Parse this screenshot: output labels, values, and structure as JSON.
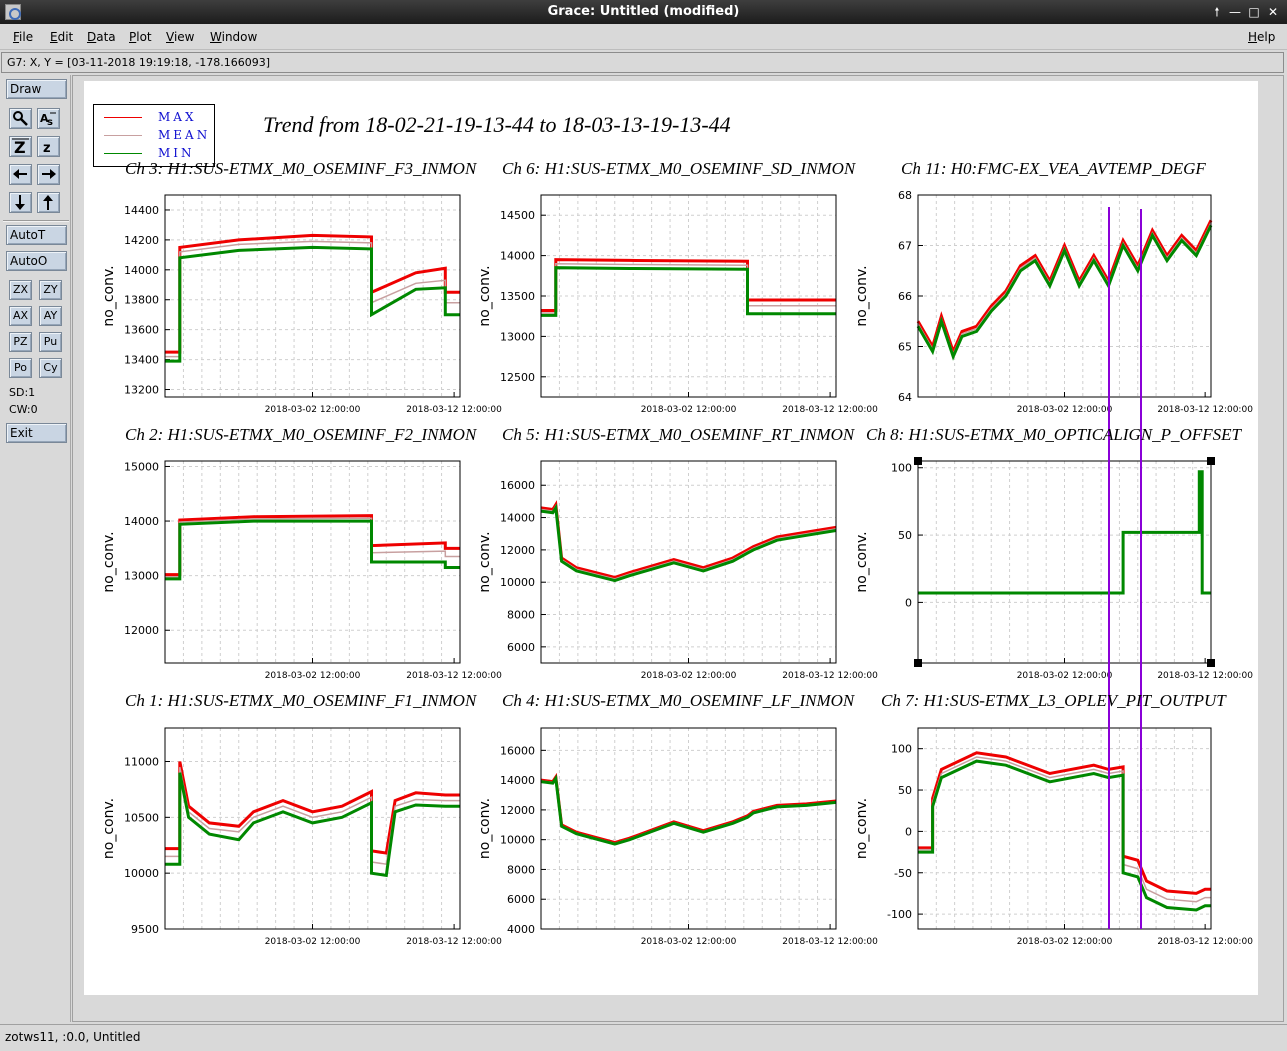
{
  "window": {
    "title": "Grace: Untitled (modified)",
    "controls": [
      "up-arrow-icon",
      "minimize-icon",
      "maximize-icon",
      "close-icon"
    ]
  },
  "menubar": {
    "items": [
      "File",
      "Edit",
      "Data",
      "Plot",
      "View",
      "Window"
    ],
    "help": "Help"
  },
  "locator": "G7: X, Y = [03-11-2018 19:19:18, -178.166093]",
  "toolbar": {
    "draw": "Draw",
    "autot": "AutoT",
    "autoo": "AutoO",
    "zx": "ZX",
    "zy": "ZY",
    "ax": "AX",
    "ay": "AY",
    "pz": "PZ",
    "pu": "Pu",
    "po": "Po",
    "cy": "Cy",
    "sd": "SD:1",
    "cw": "CW:0",
    "exit": "Exit",
    "icons": [
      "magnifier-icon",
      "autoscale-text-icon",
      "zoom-in-icon",
      "zoom-out-icon",
      "arrow-left-icon",
      "arrow-right-icon",
      "arrow-down-icon",
      "arrow-up-icon"
    ]
  },
  "status": "zotws11, :0.0, Untitled",
  "plot": {
    "title": "Trend from 18-02-21-19-13-44 to 18-03-13-19-13-44",
    "legend": [
      {
        "label": "MAX",
        "color": "#ee0000"
      },
      {
        "label": "MEAN",
        "color": "#c8a0a0"
      },
      {
        "label": "MIN",
        "color": "#008800"
      }
    ],
    "colors": {
      "max": "#ee0000",
      "mean": "#c8a0a0",
      "min": "#008800",
      "cursor": "#8a00d8"
    }
  },
  "chart_data": [
    {
      "type": "line",
      "title": "Ch 3: H1:SUS-ETMX_M0_OSEMINF_F3_INMON",
      "ylabel": "no_conv.",
      "xticks": [
        "2018-03-02 12:00:00",
        "2018-03-12 12:00:00"
      ],
      "yticks": [
        13200,
        13400,
        13600,
        13800,
        14000,
        14200,
        14400
      ],
      "ylim": [
        13150,
        14500
      ],
      "x": [
        0,
        0.05,
        0.05,
        0.25,
        0.5,
        0.7,
        0.7,
        0.85,
        0.95,
        0.95,
        1
      ],
      "series": [
        {
          "name": "MAX",
          "values": [
            13450,
            13450,
            14150,
            14200,
            14230,
            14220,
            13850,
            13980,
            14010,
            13850,
            13850
          ]
        },
        {
          "name": "MEAN",
          "values": [
            13420,
            13420,
            14120,
            14170,
            14190,
            14180,
            13780,
            13910,
            13930,
            13780,
            13780
          ]
        },
        {
          "name": "MIN",
          "values": [
            13390,
            13390,
            14080,
            14130,
            14150,
            14140,
            13700,
            13870,
            13880,
            13700,
            13700
          ]
        }
      ]
    },
    {
      "type": "line",
      "title": "Ch 6: H1:SUS-ETMX_M0_OSEMINF_SD_INMON",
      "ylabel": "no_conv.",
      "xticks": [
        "2018-03-02 12:00:00",
        "2018-03-12 12:00:00"
      ],
      "yticks": [
        12500,
        13000,
        13500,
        14000,
        14500
      ],
      "ylim": [
        12250,
        14750
      ],
      "x": [
        0,
        0.05,
        0.05,
        0.3,
        0.7,
        0.7,
        1
      ],
      "series": [
        {
          "name": "MAX",
          "values": [
            13320,
            13320,
            13950,
            13940,
            13930,
            13450,
            13450
          ]
        },
        {
          "name": "MEAN",
          "values": [
            13290,
            13290,
            13900,
            13890,
            13880,
            13380,
            13380
          ]
        },
        {
          "name": "MIN",
          "values": [
            13260,
            13260,
            13850,
            13840,
            13830,
            13280,
            13280
          ]
        }
      ]
    },
    {
      "type": "line",
      "title": "Ch 11: H0:FMC-EX_VEA_AVTEMP_DEGF",
      "ylabel": "no_conv.",
      "xticks": [
        "2018-03-02 12:00:00",
        "2018-03-12 12:00:00"
      ],
      "yticks": [
        64,
        65,
        66,
        67,
        68
      ],
      "ylim": [
        64,
        68
      ],
      "x": [
        0,
        0.05,
        0.08,
        0.12,
        0.15,
        0.2,
        0.25,
        0.3,
        0.35,
        0.4,
        0.45,
        0.5,
        0.55,
        0.6,
        0.65,
        0.7,
        0.75,
        0.8,
        0.85,
        0.9,
        0.95,
        1
      ],
      "series": [
        {
          "name": "MAX",
          "values": [
            65.5,
            65.0,
            65.6,
            64.9,
            65.3,
            65.4,
            65.8,
            66.1,
            66.6,
            66.8,
            66.3,
            67.0,
            66.3,
            66.8,
            66.3,
            67.1,
            66.6,
            67.3,
            66.8,
            67.2,
            66.9,
            67.5
          ]
        },
        {
          "name": "MEAN",
          "values": [
            65.45,
            64.95,
            65.55,
            64.85,
            65.25,
            65.35,
            65.75,
            66.05,
            66.55,
            66.75,
            66.25,
            66.95,
            66.25,
            66.75,
            66.25,
            67.05,
            66.55,
            67.25,
            66.75,
            67.15,
            66.85,
            67.45
          ]
        },
        {
          "name": "MIN",
          "values": [
            65.4,
            64.9,
            65.5,
            64.8,
            65.2,
            65.3,
            65.7,
            66.0,
            66.5,
            66.7,
            66.2,
            66.9,
            66.2,
            66.7,
            66.2,
            67.0,
            66.5,
            67.2,
            66.7,
            67.1,
            66.8,
            67.4
          ]
        }
      ]
    },
    {
      "type": "line",
      "title": "Ch 2: H1:SUS-ETMX_M0_OSEMINF_F2_INMON",
      "ylabel": "no_conv.",
      "xticks": [
        "2018-03-02 12:00:00",
        "2018-03-12 12:00:00"
      ],
      "yticks": [
        12000,
        13000,
        14000,
        15000
      ],
      "ylim": [
        11400,
        15100
      ],
      "x": [
        0,
        0.05,
        0.05,
        0.3,
        0.7,
        0.7,
        0.95,
        0.95,
        1
      ],
      "series": [
        {
          "name": "MAX",
          "values": [
            13020,
            13020,
            14020,
            14080,
            14100,
            13550,
            13600,
            13500,
            13500
          ]
        },
        {
          "name": "MEAN",
          "values": [
            12980,
            12980,
            13980,
            14040,
            14050,
            13420,
            13450,
            13350,
            13350
          ]
        },
        {
          "name": "MIN",
          "values": [
            12940,
            12940,
            13940,
            14000,
            14000,
            13250,
            13250,
            13150,
            13150
          ]
        }
      ]
    },
    {
      "type": "line",
      "title": "Ch 5: H1:SUS-ETMX_M0_OSEMINF_RT_INMON",
      "ylabel": "no_conv.",
      "xticks": [
        "2018-03-02 12:00:00",
        "2018-03-12 12:00:00"
      ],
      "yticks": [
        6000,
        8000,
        10000,
        12000,
        14000,
        16000
      ],
      "ylim": [
        5000,
        17500
      ],
      "x": [
        0,
        0.04,
        0.05,
        0.07,
        0.12,
        0.25,
        0.3,
        0.45,
        0.55,
        0.65,
        0.7,
        0.72,
        0.8,
        0.9,
        1
      ],
      "series": [
        {
          "name": "MAX",
          "values": [
            14600,
            14500,
            14800,
            11500,
            10900,
            10300,
            10600,
            11400,
            10900,
            11500,
            12000,
            12200,
            12800,
            13100,
            13400
          ]
        },
        {
          "name": "MEAN",
          "values": [
            14500,
            14400,
            14700,
            11400,
            10800,
            10200,
            10500,
            11300,
            10800,
            11400,
            11900,
            12100,
            12700,
            13000,
            13300
          ]
        },
        {
          "name": "MIN",
          "values": [
            14400,
            14300,
            14600,
            11300,
            10700,
            10100,
            10400,
            11200,
            10700,
            11300,
            11800,
            12000,
            12600,
            12900,
            13200
          ]
        }
      ]
    },
    {
      "type": "line",
      "title": "Ch 8: H1:SUS-ETMX_M0_OPTICALIGN_P_OFFSET",
      "ylabel": "no_conv.",
      "xticks": [
        "2018-03-02 12:00:00",
        "2018-03-12 12:00:00"
      ],
      "yticks": [
        0,
        50,
        100
      ],
      "ylim": [
        -45,
        105
      ],
      "x": [
        0,
        0.7,
        0.7,
        0.96,
        0.96,
        0.97,
        0.97,
        1
      ],
      "series": [
        {
          "name": "MIN",
          "values": [
            7,
            7,
            52,
            52,
            97,
            97,
            7,
            7
          ]
        }
      ]
    },
    {
      "type": "line",
      "title": "Ch 1: H1:SUS-ETMX_M0_OSEMINF_F1_INMON",
      "ylabel": "no_conv.",
      "xticks": [
        "2018-03-02 12:00:00",
        "2018-03-12 12:00:00"
      ],
      "yticks": [
        9500,
        10000,
        10500,
        11000
      ],
      "ylim": [
        9500,
        11300
      ],
      "x": [
        0,
        0.05,
        0.05,
        0.08,
        0.15,
        0.25,
        0.3,
        0.4,
        0.5,
        0.6,
        0.7,
        0.7,
        0.75,
        0.78,
        0.85,
        0.95,
        0.95,
        1
      ],
      "series": [
        {
          "name": "MAX",
          "values": [
            10220,
            10220,
            11000,
            10600,
            10450,
            10420,
            10550,
            10650,
            10550,
            10600,
            10730,
            10200,
            10180,
            10650,
            10720,
            10700,
            10700,
            10700
          ]
        },
        {
          "name": "MEAN",
          "values": [
            10150,
            10150,
            10950,
            10550,
            10400,
            10370,
            10500,
            10600,
            10500,
            10550,
            10680,
            10100,
            10080,
            10600,
            10660,
            10650,
            10650,
            10650
          ]
        },
        {
          "name": "MIN",
          "values": [
            10080,
            10080,
            10900,
            10500,
            10350,
            10300,
            10450,
            10550,
            10450,
            10500,
            10630,
            10000,
            9980,
            10550,
            10610,
            10600,
            10600,
            10600
          ]
        }
      ]
    },
    {
      "type": "line",
      "title": "Ch 4: H1:SUS-ETMX_M0_OSEMINF_LF_INMON",
      "ylabel": "no_conv.",
      "xticks": [
        "2018-03-02 12:00:00",
        "2018-03-12 12:00:00"
      ],
      "yticks": [
        4000,
        6000,
        8000,
        10000,
        12000,
        14000,
        16000
      ],
      "ylim": [
        4000,
        17500
      ],
      "x": [
        0,
        0.04,
        0.05,
        0.07,
        0.12,
        0.25,
        0.3,
        0.45,
        0.55,
        0.65,
        0.7,
        0.72,
        0.8,
        0.9,
        1
      ],
      "series": [
        {
          "name": "MAX",
          "values": [
            14000,
            13900,
            14200,
            11000,
            10500,
            9800,
            10100,
            11200,
            10600,
            11200,
            11600,
            11900,
            12300,
            12400,
            12600
          ]
        },
        {
          "name": "MEAN",
          "values": [
            13950,
            13850,
            14150,
            10950,
            10450,
            9750,
            10050,
            11150,
            10550,
            11150,
            11550,
            11850,
            12250,
            12350,
            12550
          ]
        },
        {
          "name": "MIN",
          "values": [
            13900,
            13800,
            14100,
            10900,
            10400,
            9700,
            10000,
            11100,
            10500,
            11100,
            11500,
            11800,
            12200,
            12300,
            12500
          ]
        }
      ]
    },
    {
      "type": "line",
      "title": "Ch 7: H1:SUS-ETMX_L3_OPLEV_PIT_OUTPUT",
      "ylabel": "no_conv.",
      "xticks": [
        "2018-03-02 12:00:00",
        "2018-03-12 12:00:00"
      ],
      "yticks": [
        -100,
        -50,
        0,
        50,
        100
      ],
      "ylim": [
        -118,
        125
      ],
      "x": [
        0,
        0.05,
        0.05,
        0.08,
        0.2,
        0.3,
        0.45,
        0.6,
        0.65,
        0.7,
        0.7,
        0.75,
        0.78,
        0.85,
        0.95,
        0.98,
        1
      ],
      "series": [
        {
          "name": "MAX",
          "values": [
            -20,
            -20,
            40,
            75,
            95,
            90,
            70,
            80,
            75,
            78,
            -30,
            -35,
            -60,
            -72,
            -75,
            -70,
            -70
          ]
        },
        {
          "name": "MEAN",
          "values": [
            -22,
            -22,
            35,
            70,
            90,
            85,
            65,
            75,
            70,
            73,
            -40,
            -45,
            -70,
            -82,
            -85,
            -80,
            -80
          ]
        },
        {
          "name": "MIN",
          "values": [
            -25,
            -25,
            30,
            65,
            85,
            80,
            60,
            70,
            65,
            68,
            -50,
            -55,
            -80,
            -92,
            -95,
            -90,
            -90
          ]
        }
      ]
    }
  ]
}
